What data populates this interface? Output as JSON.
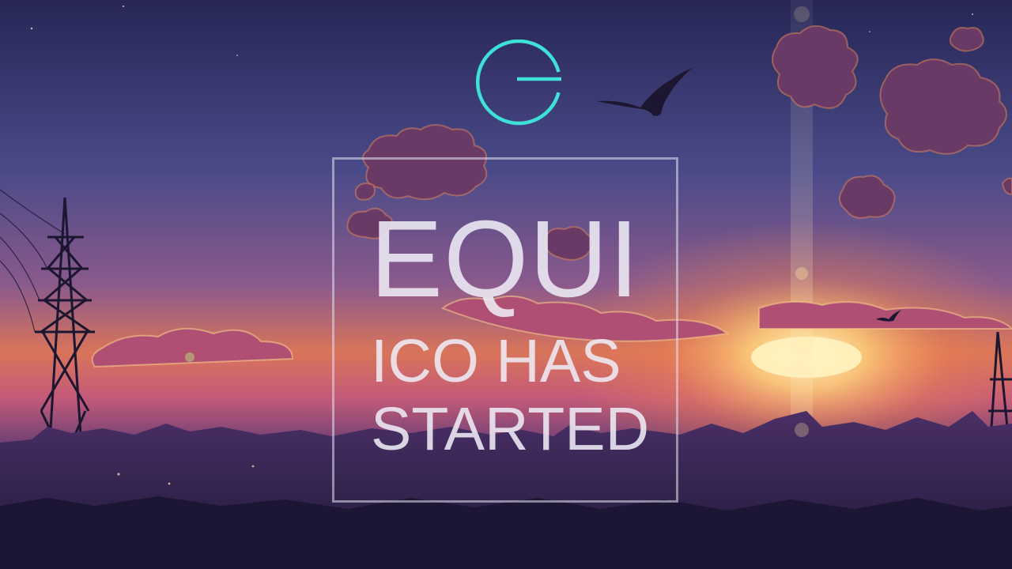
{
  "brand": {
    "logo_icon": "g-ring-logo-icon",
    "accent_color": "#3fe0d8"
  },
  "headline": {
    "title": "EQUI",
    "line1": "ICO HAS",
    "line2": "STARTED"
  },
  "colors": {
    "sky_top": "#2c2a5e",
    "sky_mid": "#5a4f8f",
    "horizon": "#f08a4c",
    "sun": "#ffe79a",
    "city": "#2a2248",
    "frame_border": "#e1e1f0"
  }
}
